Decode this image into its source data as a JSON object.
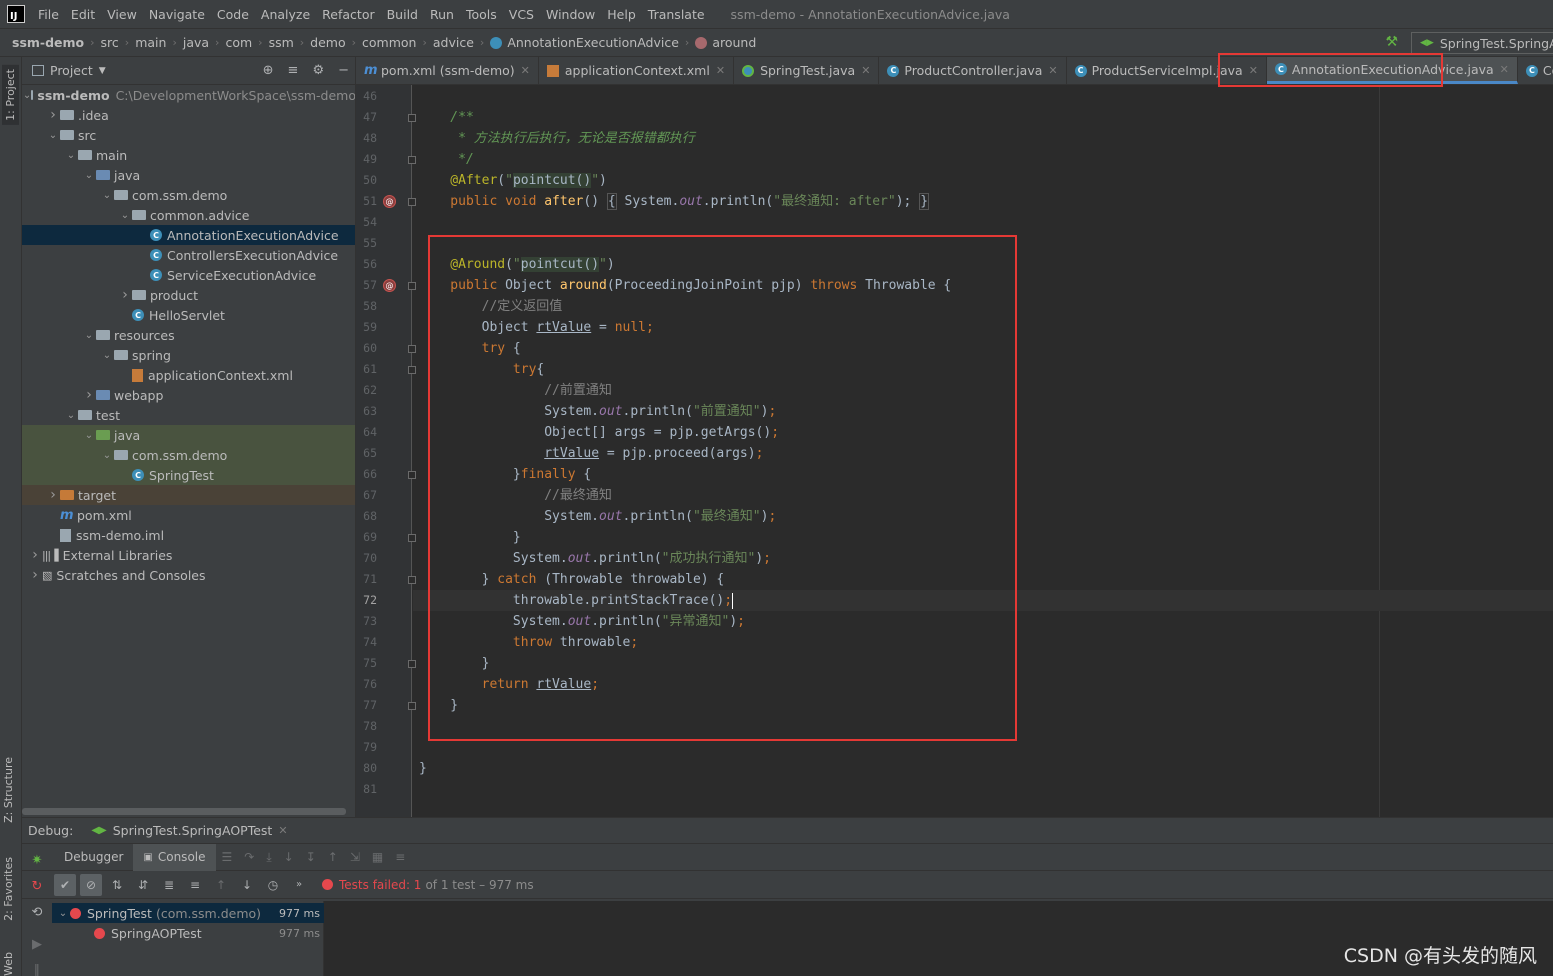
{
  "menu": {
    "items": [
      "File",
      "Edit",
      "View",
      "Navigate",
      "Code",
      "Analyze",
      "Refactor",
      "Build",
      "Run",
      "Tools",
      "VCS",
      "Window",
      "Help",
      "Translate"
    ],
    "window_title": "ssm-demo - AnnotationExecutionAdvice.java"
  },
  "breadcrumbs": [
    "ssm-demo",
    "src",
    "main",
    "java",
    "com",
    "ssm",
    "demo",
    "common",
    "advice",
    "AnnotationExecutionAdvice",
    "around"
  ],
  "run_config": "SpringTest.SpringAOPTest",
  "tool_windows": {
    "project": "1: Project",
    "structure": "Z: Structure",
    "favorites": "2: Favorites",
    "web": "Web"
  },
  "project_panel": {
    "title": "Project",
    "tree": [
      {
        "label": "ssm-demo",
        "path": "C:\\DevelopmentWorkSpace\\ssm-demo",
        "depth": 0,
        "icon": "module",
        "arrow": "down",
        "bold": true
      },
      {
        "label": ".idea",
        "depth": 1,
        "icon": "folder",
        "arrow": "right"
      },
      {
        "label": "src",
        "depth": 1,
        "icon": "folder",
        "arrow": "down"
      },
      {
        "label": "main",
        "depth": 2,
        "icon": "folder",
        "arrow": "down"
      },
      {
        "label": "java",
        "depth": 3,
        "icon": "folder-blue",
        "arrow": "down"
      },
      {
        "label": "com.ssm.demo",
        "depth": 4,
        "icon": "package",
        "arrow": "down"
      },
      {
        "label": "common.advice",
        "depth": 5,
        "icon": "package",
        "arrow": "down"
      },
      {
        "label": "AnnotationExecutionAdvice",
        "depth": 6,
        "icon": "class",
        "arrow": "",
        "selected": true
      },
      {
        "label": "ControllersExecutionAdvice",
        "depth": 6,
        "icon": "class",
        "arrow": ""
      },
      {
        "label": "ServiceExecutionAdvice",
        "depth": 6,
        "icon": "class",
        "arrow": ""
      },
      {
        "label": "product",
        "depth": 5,
        "icon": "package",
        "arrow": "right"
      },
      {
        "label": "HelloServlet",
        "depth": 5,
        "icon": "class",
        "arrow": ""
      },
      {
        "label": "resources",
        "depth": 3,
        "icon": "folder-res",
        "arrow": "down"
      },
      {
        "label": "spring",
        "depth": 4,
        "icon": "folder",
        "arrow": "down"
      },
      {
        "label": "applicationContext.xml",
        "depth": 5,
        "icon": "xml",
        "arrow": ""
      },
      {
        "label": "webapp",
        "depth": 3,
        "icon": "folder-web",
        "arrow": "right"
      },
      {
        "label": "test",
        "depth": 2,
        "icon": "folder",
        "arrow": "down"
      },
      {
        "label": "java",
        "depth": 3,
        "icon": "folder-green",
        "arrow": "down",
        "test": true
      },
      {
        "label": "com.ssm.demo",
        "depth": 4,
        "icon": "package",
        "arrow": "down",
        "test": true
      },
      {
        "label": "SpringTest",
        "depth": 5,
        "icon": "class-test",
        "arrow": "",
        "test": true
      },
      {
        "label": "target",
        "depth": 1,
        "icon": "folder-orange",
        "arrow": "right",
        "excluded": true
      },
      {
        "label": "pom.xml",
        "depth": 1,
        "icon": "maven",
        "arrow": ""
      },
      {
        "label": "ssm-demo.iml",
        "depth": 1,
        "icon": "iml",
        "arrow": ""
      },
      {
        "label": "External Libraries",
        "depth": 0,
        "icon": "libs",
        "arrow": "right"
      },
      {
        "label": "Scratches and Consoles",
        "depth": 0,
        "icon": "scratches",
        "arrow": "right"
      }
    ]
  },
  "tabs": [
    {
      "label": "pom.xml (ssm-demo)",
      "icon": "maven"
    },
    {
      "label": "applicationContext.xml",
      "icon": "xml"
    },
    {
      "label": "SpringTest.java",
      "icon": "class-test"
    },
    {
      "label": "ProductController.java",
      "icon": "class"
    },
    {
      "label": "ProductServiceImpl.java",
      "icon": "class"
    },
    {
      "label": "AnnotationExecutionAdvice.java",
      "icon": "class",
      "active": true
    },
    {
      "label": "ControllersExecu",
      "icon": "class"
    }
  ],
  "editor": {
    "current_line": "72",
    "lines": [
      {
        "n": "46",
        "t": [
          [
            "",
            ""
          ]
        ]
      },
      {
        "n": "47",
        "t": [
          [
            "doc",
            "    /**"
          ]
        ]
      },
      {
        "n": "48",
        "t": [
          [
            "doc",
            "     * 方法执行后执行，无论是否报错都执行"
          ]
        ]
      },
      {
        "n": "49",
        "t": [
          [
            "doc",
            "     */"
          ]
        ]
      },
      {
        "n": "50",
        "t": [
          [
            "ann",
            "    @After"
          ],
          [
            "",
            "("
          ],
          [
            "str",
            "\""
          ],
          [
            "ptc",
            "pointcut()"
          ],
          [
            "str",
            "\""
          ],
          [
            "",
            ")"
          ]
        ]
      },
      {
        "n": "51",
        "t": [
          [
            "kw",
            "    public void "
          ],
          [
            "fn",
            "after"
          ],
          [
            "",
            "() "
          ],
          [
            "brace",
            "{"
          ],
          [
            "",
            " System."
          ],
          [
            "static",
            "out"
          ],
          [
            "",
            ".println("
          ],
          [
            "str",
            "\"最终通知: after\""
          ],
          [
            "",
            "); "
          ],
          [
            "brace",
            "}"
          ]
        ]
      },
      {
        "n": "54",
        "t": [
          [
            "",
            ""
          ]
        ]
      },
      {
        "n": "55",
        "t": [
          [
            "",
            ""
          ]
        ]
      },
      {
        "n": "56",
        "t": [
          [
            "ann",
            "    @Around"
          ],
          [
            "",
            "("
          ],
          [
            "str",
            "\""
          ],
          [
            "ptc",
            "pointcut()"
          ],
          [
            "str",
            "\""
          ],
          [
            "",
            ")"
          ]
        ]
      },
      {
        "n": "57",
        "t": [
          [
            "kw",
            "    public "
          ],
          [
            "",
            "Object "
          ],
          [
            "fn",
            "around"
          ],
          [
            "",
            "(ProceedingJoinPoint pjp) "
          ],
          [
            "kw",
            "throws "
          ],
          [
            "",
            "Throwable {"
          ]
        ]
      },
      {
        "n": "58",
        "t": [
          [
            "cmt",
            "        //定义返回值"
          ]
        ]
      },
      {
        "n": "59",
        "t": [
          [
            "",
            "        Object "
          ],
          [
            "var",
            "rtValue"
          ],
          [
            "",
            " = "
          ],
          [
            "kw",
            "null"
          ],
          [
            "kw",
            ";"
          ]
        ]
      },
      {
        "n": "60",
        "t": [
          [
            "kw",
            "        try "
          ],
          [
            "",
            "{"
          ]
        ]
      },
      {
        "n": "61",
        "t": [
          [
            "kw",
            "            try"
          ],
          [
            "",
            "{"
          ]
        ]
      },
      {
        "n": "62",
        "t": [
          [
            "cmt",
            "                //前置通知"
          ]
        ]
      },
      {
        "n": "63",
        "t": [
          [
            "",
            "                System."
          ],
          [
            "static",
            "out"
          ],
          [
            "",
            ".println("
          ],
          [
            "str",
            "\"前置通知\""
          ],
          [
            "",
            ")"
          ],
          [
            "kw",
            ";"
          ]
        ]
      },
      {
        "n": "64",
        "t": [
          [
            "",
            "                Object[] args = pjp.getArgs()"
          ],
          [
            "kw",
            ";"
          ]
        ]
      },
      {
        "n": "65",
        "t": [
          [
            "",
            "                "
          ],
          [
            "var",
            "rtValue"
          ],
          [
            "",
            " = pjp.proceed(args)"
          ],
          [
            "kw",
            ";"
          ]
        ]
      },
      {
        "n": "66",
        "t": [
          [
            "",
            "            }"
          ],
          [
            "kw",
            "finally "
          ],
          [
            "",
            "{"
          ]
        ]
      },
      {
        "n": "67",
        "t": [
          [
            "cmt",
            "                //最终通知"
          ]
        ]
      },
      {
        "n": "68",
        "t": [
          [
            "",
            "                System."
          ],
          [
            "static",
            "out"
          ],
          [
            "",
            ".println("
          ],
          [
            "str",
            "\"最终通知\""
          ],
          [
            "",
            ")"
          ],
          [
            "kw",
            ";"
          ]
        ]
      },
      {
        "n": "69",
        "t": [
          [
            "",
            "            }"
          ]
        ]
      },
      {
        "n": "70",
        "t": [
          [
            "",
            "            System."
          ],
          [
            "static",
            "out"
          ],
          [
            "",
            ".println("
          ],
          [
            "str",
            "\"成功执行通知\""
          ],
          [
            "",
            ")"
          ],
          [
            "kw",
            ";"
          ]
        ]
      },
      {
        "n": "71",
        "t": [
          [
            "",
            "        } "
          ],
          [
            "kw",
            "catch "
          ],
          [
            "",
            "(Throwable throwable) {"
          ]
        ]
      },
      {
        "n": "72",
        "t": [
          [
            "",
            "            throwable.printStackTrace()"
          ],
          [
            "kw",
            ";"
          ]
        ]
      },
      {
        "n": "73",
        "t": [
          [
            "",
            "            System."
          ],
          [
            "static",
            "out"
          ],
          [
            "",
            ".println("
          ],
          [
            "str",
            "\"异常通知\""
          ],
          [
            "",
            ")"
          ],
          [
            "kw",
            ";"
          ]
        ]
      },
      {
        "n": "74",
        "t": [
          [
            "kw",
            "            throw "
          ],
          [
            "",
            "throwable"
          ],
          [
            "kw",
            ";"
          ]
        ]
      },
      {
        "n": "75",
        "t": [
          [
            "",
            "        }"
          ]
        ]
      },
      {
        "n": "76",
        "t": [
          [
            "kw",
            "        return "
          ],
          [
            "var",
            "rtValue"
          ],
          [
            "kw",
            ";"
          ]
        ]
      },
      {
        "n": "77",
        "t": [
          [
            "",
            "    }"
          ]
        ]
      },
      {
        "n": "78",
        "t": [
          [
            "",
            ""
          ]
        ]
      },
      {
        "n": "79",
        "t": [
          [
            "",
            ""
          ]
        ]
      },
      {
        "n": "80",
        "t": [
          [
            "",
            "}"
          ]
        ]
      },
      {
        "n": "81",
        "t": [
          [
            "",
            ""
          ]
        ]
      }
    ]
  },
  "debug": {
    "label": "Debug:",
    "config": "SpringTest.SpringAOPTest",
    "subtabs": [
      "Debugger",
      "Console"
    ],
    "status_failed": "Tests failed: 1",
    "status_rest": "of 1 test – 977 ms",
    "tests": [
      {
        "name": "SpringTest",
        "pkg": "(com.ssm.demo)",
        "time": "977 ms"
      },
      {
        "name": "SpringAOPTest",
        "pkg": "",
        "time": "977 ms"
      }
    ]
  },
  "watermark": "CSDN @有头发的随风",
  "colors": {
    "highlight_box": "#e53935",
    "accent": "#4a88c7",
    "error": "#e5484d"
  }
}
